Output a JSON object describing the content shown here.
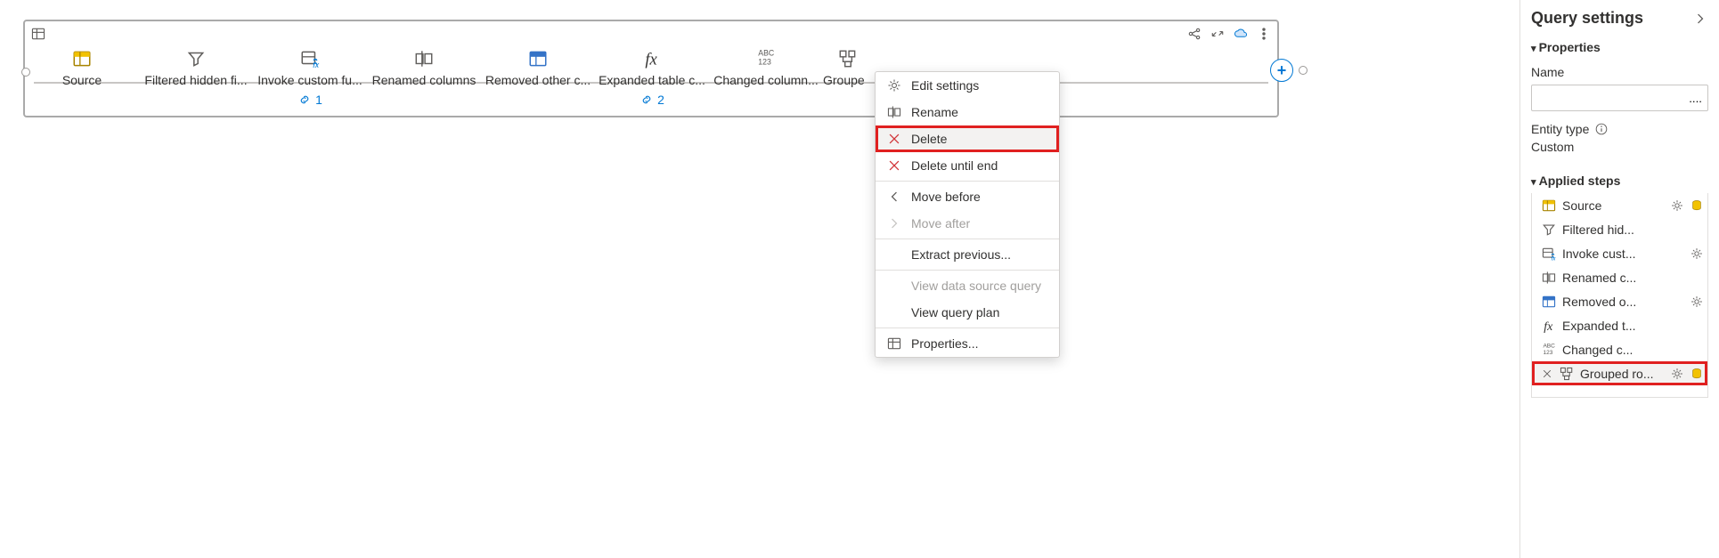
{
  "steps": {
    "source": "Source",
    "filtered": "Filtered hidden fi...",
    "invoke": "Invoke custom fu...",
    "renamed": "Renamed columns",
    "removed": "Removed other c...",
    "expanded": "Expanded table c...",
    "changed": "Changed column...",
    "grouped": "Groupe",
    "count1": "1",
    "count2": "2"
  },
  "context_menu": {
    "edit_settings": "Edit settings",
    "rename": "Rename",
    "delete": "Delete",
    "delete_until_end": "Delete until end",
    "move_before": "Move before",
    "move_after": "Move after",
    "extract_previous": "Extract previous...",
    "view_data_source_query": "View data source query",
    "view_query_plan": "View query plan",
    "properties": "Properties..."
  },
  "panel": {
    "title": "Query settings",
    "properties": "Properties",
    "name_label": "Name",
    "name_value": "....",
    "entity_type_label": "Entity type",
    "entity_type_value": "Custom",
    "applied_steps": "Applied steps",
    "steps": {
      "source": "Source",
      "filtered": "Filtered hid...",
      "invoke": "Invoke cust...",
      "renamed": "Renamed c...",
      "removed": "Removed o...",
      "expanded": "Expanded t...",
      "changed": "Changed c...",
      "grouped": "Grouped ro..."
    }
  }
}
